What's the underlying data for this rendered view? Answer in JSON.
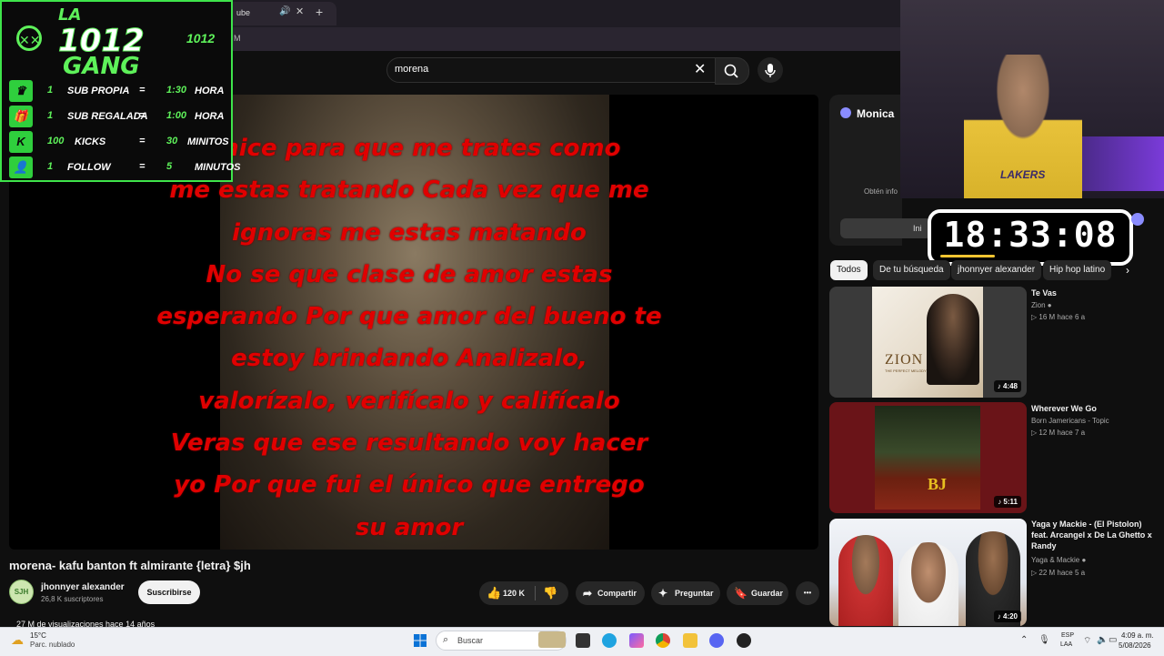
{
  "browser": {
    "tab_title": "ube",
    "tab_audio_icon": "speaker-icon",
    "tab_close": "✕",
    "new_tab": "+",
    "address_fragment": "M"
  },
  "youtube": {
    "search": {
      "value": "morena",
      "clear": "✕",
      "search_icon": "🔍",
      "mic_icon": "🎤"
    },
    "video": {
      "lyrics": [
        "e hice para que me trates como",
        "me estas tratando Cada vez que me",
        "ignoras me estas matando",
        "No se que clase de amor estas",
        "esperando Por que amor del bueno te",
        "estoy brindando Analizalo,",
        "valorízalo, verifícalo y califícalo",
        "Veras que ese resultando voy hacer",
        "yo Por que fui el único que entrego",
        "su amor"
      ],
      "lyrics_color": "#e00000"
    },
    "title": "morena- kafu banton ft almirante {letra} $jh",
    "channel": {
      "name": "jhonnyer alexander",
      "subscribers": "26,8 K suscriptores",
      "avatar_text": "SJH"
    },
    "subscribe_label": "Suscribirse",
    "actions": {
      "like_count": "120 K",
      "share": "Compartir",
      "ask": "Preguntar",
      "save": "Guardar",
      "more": "•••"
    },
    "views": "27 M de visualizaciones  hace 14 años",
    "chips": [
      "Todos",
      "De tu búsqueda",
      "jhonnyer alexander",
      "Hip hop latino"
    ],
    "recommendations": [
      {
        "title": "Te Vas",
        "channel": "Zion",
        "meta": "▷ 16 M  hace 6 a",
        "duration": "♪ 4:48",
        "thumb_label": "ZION",
        "thumb_sub": "THE PERFECT MELODY"
      },
      {
        "title": "Wherever We Go",
        "channel": "Born Jamericans - Topic",
        "meta": "▷ 12 M  hace 7 a",
        "duration": "♪ 5:11",
        "thumb_label": "BJ"
      },
      {
        "title": "Yaga y Mackie - (El Pistolon) feat. Arcangel x De La Ghetto x Randy",
        "channel": "Yaga & Mackie",
        "meta": "▷ 22 M  hace 5 a",
        "duration": "♪ 4:20"
      }
    ]
  },
  "monica": {
    "name": "Monica",
    "desc": "Obtén info",
    "button": "Ini"
  },
  "overlay": {
    "logo_line1": "LA",
    "logo_line2": "1012",
    "logo_line3": "GANG",
    "logo_small": "1012",
    "rows": [
      {
        "icon": "crown-icon",
        "glyph": "♛",
        "num": "1",
        "label": "SUB PROPIA",
        "eq": "=",
        "value": "1:30",
        "unit": "HORA"
      },
      {
        "icon": "gift-icon",
        "glyph": "🎁",
        "num": "1",
        "label": "SUB REGALADA",
        "eq": "=",
        "value": "1:00",
        "unit": "HORA"
      },
      {
        "icon": "kick-icon",
        "glyph": "K",
        "num": "100",
        "label": "KICKS",
        "eq": "=",
        "value": "30",
        "unit": "MINITOS"
      },
      {
        "icon": "follow-icon",
        "glyph": "👤",
        "num": "1",
        "label": "FOLLOW",
        "eq": "=",
        "value": "5",
        "unit": "MINUTOS"
      }
    ],
    "accent": "#5ef15a"
  },
  "webcam": {
    "jersey_text": "LAKERS"
  },
  "clock": {
    "time": "18:33:08"
  },
  "taskbar": {
    "weather_temp": "15°C",
    "weather_desc": "Parc. nublado",
    "search_placeholder": "Buscar",
    "lang_line1": "ESP",
    "lang_line2": "LAA",
    "time": "4:09 a. m.",
    "date": "5/08/2026"
  }
}
